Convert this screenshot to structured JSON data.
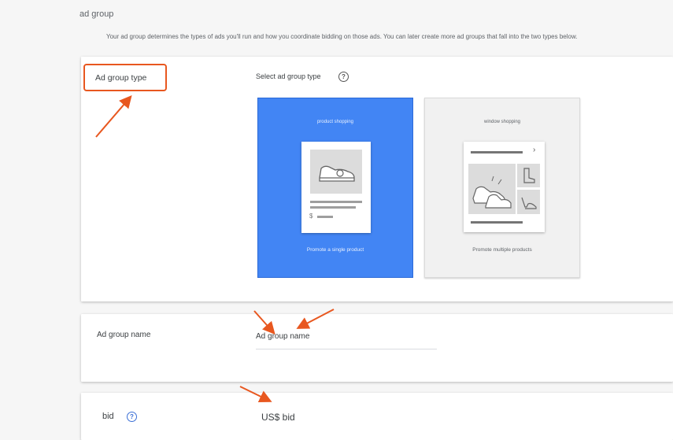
{
  "header": {
    "title": "ad group",
    "description": "Your ad group determines the types of ads you'll run and how you coordinate bidding on those ads. You can later create more ad groups that fall into the two types below."
  },
  "ad_group_type": {
    "label": "Ad group type",
    "select_label": "Select ad group type",
    "help_icon": "?",
    "options": [
      {
        "title": "product shopping",
        "caption": "Promote a single product",
        "selected": true
      },
      {
        "title": "window shopping",
        "caption": "Promote multiple products",
        "selected": false
      }
    ],
    "dollar_sign": "$"
  },
  "ad_group_name": {
    "label": "Ad group name",
    "placeholder": "Ad group name"
  },
  "bid": {
    "label": "bid",
    "help_icon": "?",
    "currency_label": "US$ bid"
  },
  "colors": {
    "accent": "#4285f4",
    "annotation": "#e8571f"
  },
  "icons": [
    "help-icon",
    "sneaker-icon",
    "boot-icon",
    "heel-icon",
    "chevron-right-icon",
    "annotation-arrow"
  ]
}
